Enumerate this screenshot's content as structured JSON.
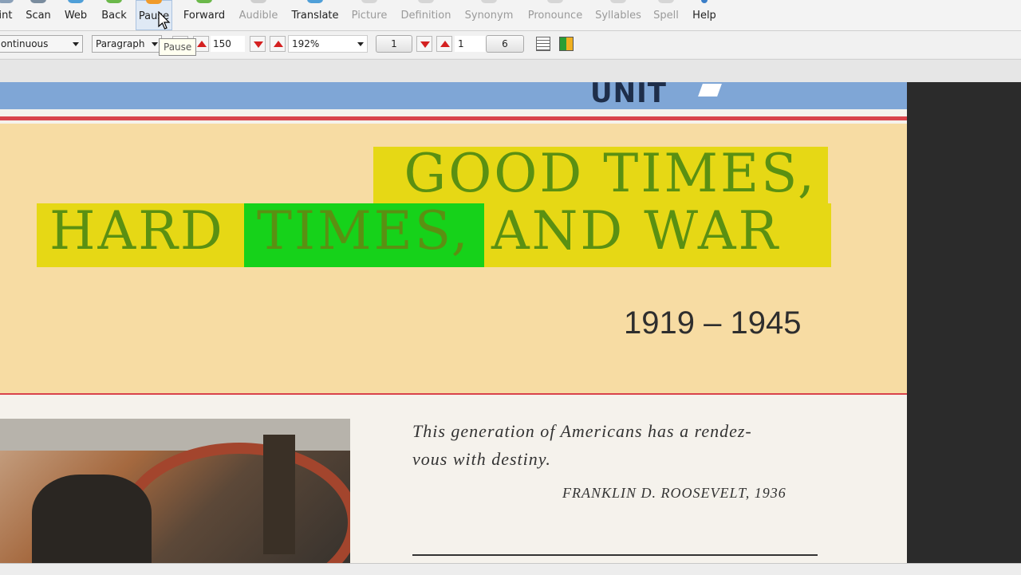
{
  "menu": {
    "items": [
      {
        "label": "int",
        "state": "normal",
        "icon": "print-icon"
      },
      {
        "label": "Scan",
        "state": "normal",
        "icon": "scan-icon"
      },
      {
        "label": "Web",
        "state": "normal",
        "icon": "web-icon"
      },
      {
        "label": "Back",
        "state": "normal",
        "icon": "back-icon"
      },
      {
        "label": "Pause",
        "state": "normal",
        "icon": "pause-icon"
      },
      {
        "label": "Forward",
        "state": "normal",
        "icon": "forward-icon"
      },
      {
        "label": "Audible",
        "state": "disabled",
        "icon": "audible-icon"
      },
      {
        "label": "Translate",
        "state": "normal",
        "icon": "translate-icon"
      },
      {
        "label": "Picture",
        "state": "disabled",
        "icon": "picture-icon"
      },
      {
        "label": "Definition",
        "state": "disabled",
        "icon": "definition-icon"
      },
      {
        "label": "Synonym",
        "state": "disabled",
        "icon": "synonym-icon"
      },
      {
        "label": "Pronounce",
        "state": "disabled",
        "icon": "pronounce-icon"
      },
      {
        "label": "Syllables",
        "state": "disabled",
        "icon": "syllables-icon"
      },
      {
        "label": "Spell",
        "state": "disabled",
        "icon": "spell-icon"
      },
      {
        "label": "Help",
        "state": "normal",
        "icon": "help-icon"
      }
    ]
  },
  "toolbar": {
    "reading_mode": "ontinuous",
    "reading_unit": "Paragraph",
    "speed": "150",
    "zoom": "192%",
    "page_field": "1",
    "page_current": "1",
    "page_total": "6"
  },
  "tooltip": "Pause",
  "document": {
    "unit_label": "UNIT",
    "title_line1": "GOOD TIMES,",
    "title_line2_a": "HARD",
    "title_line2_b": "TIMES,",
    "title_line2_c": "AND WAR",
    "years": "1919 – 1945",
    "quote": "This generation of Americans has a rendez-vous with destiny.",
    "quote_line1": "This generation of Americans has a rendez-",
    "quote_line2": "vous with destiny.",
    "attribution": "FRANKLIN D. ROOSEVELT, 1936"
  },
  "colors": {
    "highlight_sentence": "#e6d815",
    "highlight_word": "#16d21a",
    "title_text": "#5a9012",
    "accent_red": "#d9434b"
  }
}
